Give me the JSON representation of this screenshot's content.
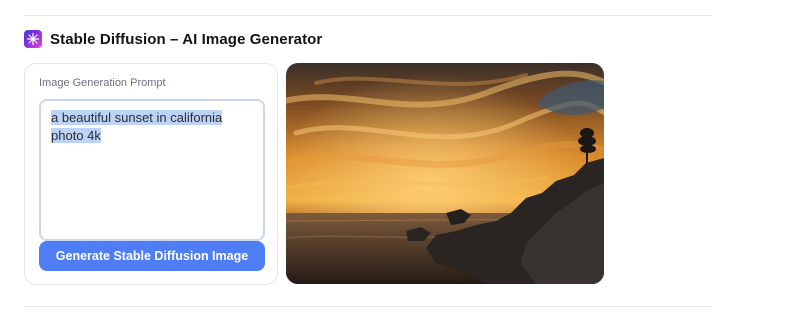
{
  "header": {
    "title": "Stable Diffusion – AI Image Generator",
    "logo_icon": "sparkle-icon"
  },
  "form": {
    "prompt_label": "Image Generation Prompt",
    "prompt_value": "a beautiful sunset in california photo 4k",
    "prompt_selected": true,
    "generate_label": "Generate Stable Diffusion Image"
  },
  "colors": {
    "accent": "#4f7df5",
    "selection": "#bcd3f5"
  },
  "result": {
    "image_subject": "sunset-over-rocky-coast"
  }
}
